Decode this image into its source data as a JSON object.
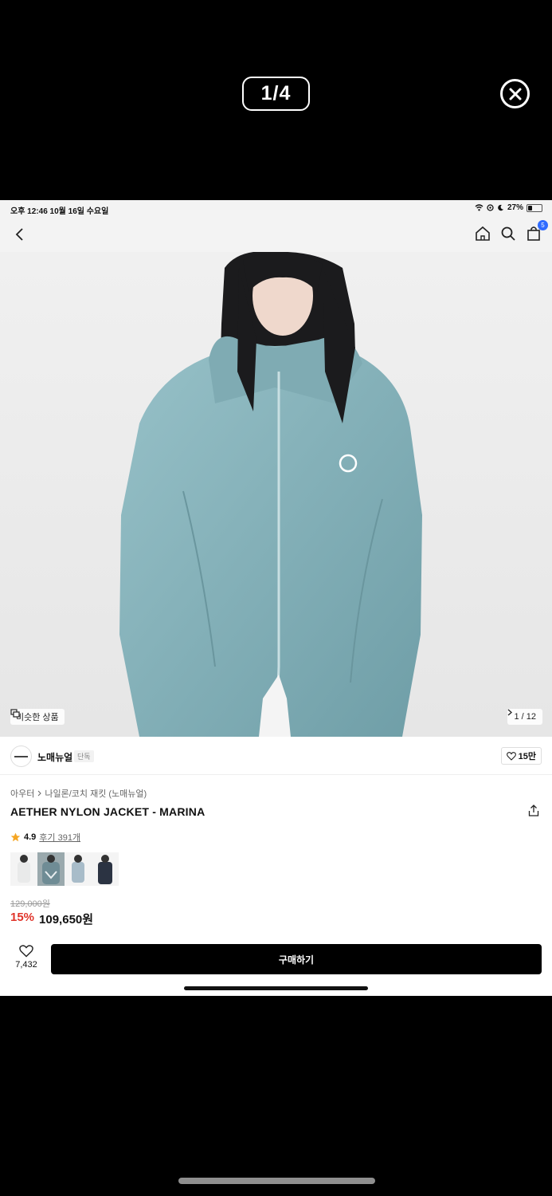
{
  "viewer": {
    "page_counter": "1/4"
  },
  "status_bar": {
    "time": "오후 12:46   10월 16일 수요일",
    "battery": "27%"
  },
  "nav": {
    "cart_count": "5"
  },
  "hero": {
    "similar_label": "비슷한 상품",
    "image_counter": "1 / 12"
  },
  "brand": {
    "name": "노매뉴얼",
    "tag": "단독",
    "likes": "15만"
  },
  "breadcrumb": [
    "아우터",
    "나일론/코치 재킷 (노매뉴얼)"
  ],
  "product": {
    "title": "AETHER NYLON JACKET - MARINA",
    "rating": "4.9",
    "reviews": "후기 391개",
    "original_price": "129,000원",
    "discount": "15%",
    "price": "109,650원"
  },
  "swatches": [
    {
      "name": "white",
      "color": "#e9eaea"
    },
    {
      "name": "marina",
      "color": "#7f9aa3"
    },
    {
      "name": "light-blue",
      "color": "#a8bcc9"
    },
    {
      "name": "navy",
      "color": "#2b3342"
    }
  ],
  "buy_bar": {
    "wish_count": "7,432",
    "buy_label": "구매하기"
  },
  "colors": {
    "jacket": "#86b2ba",
    "accent_badge": "#2f6bff",
    "discount": "#e0342a"
  }
}
